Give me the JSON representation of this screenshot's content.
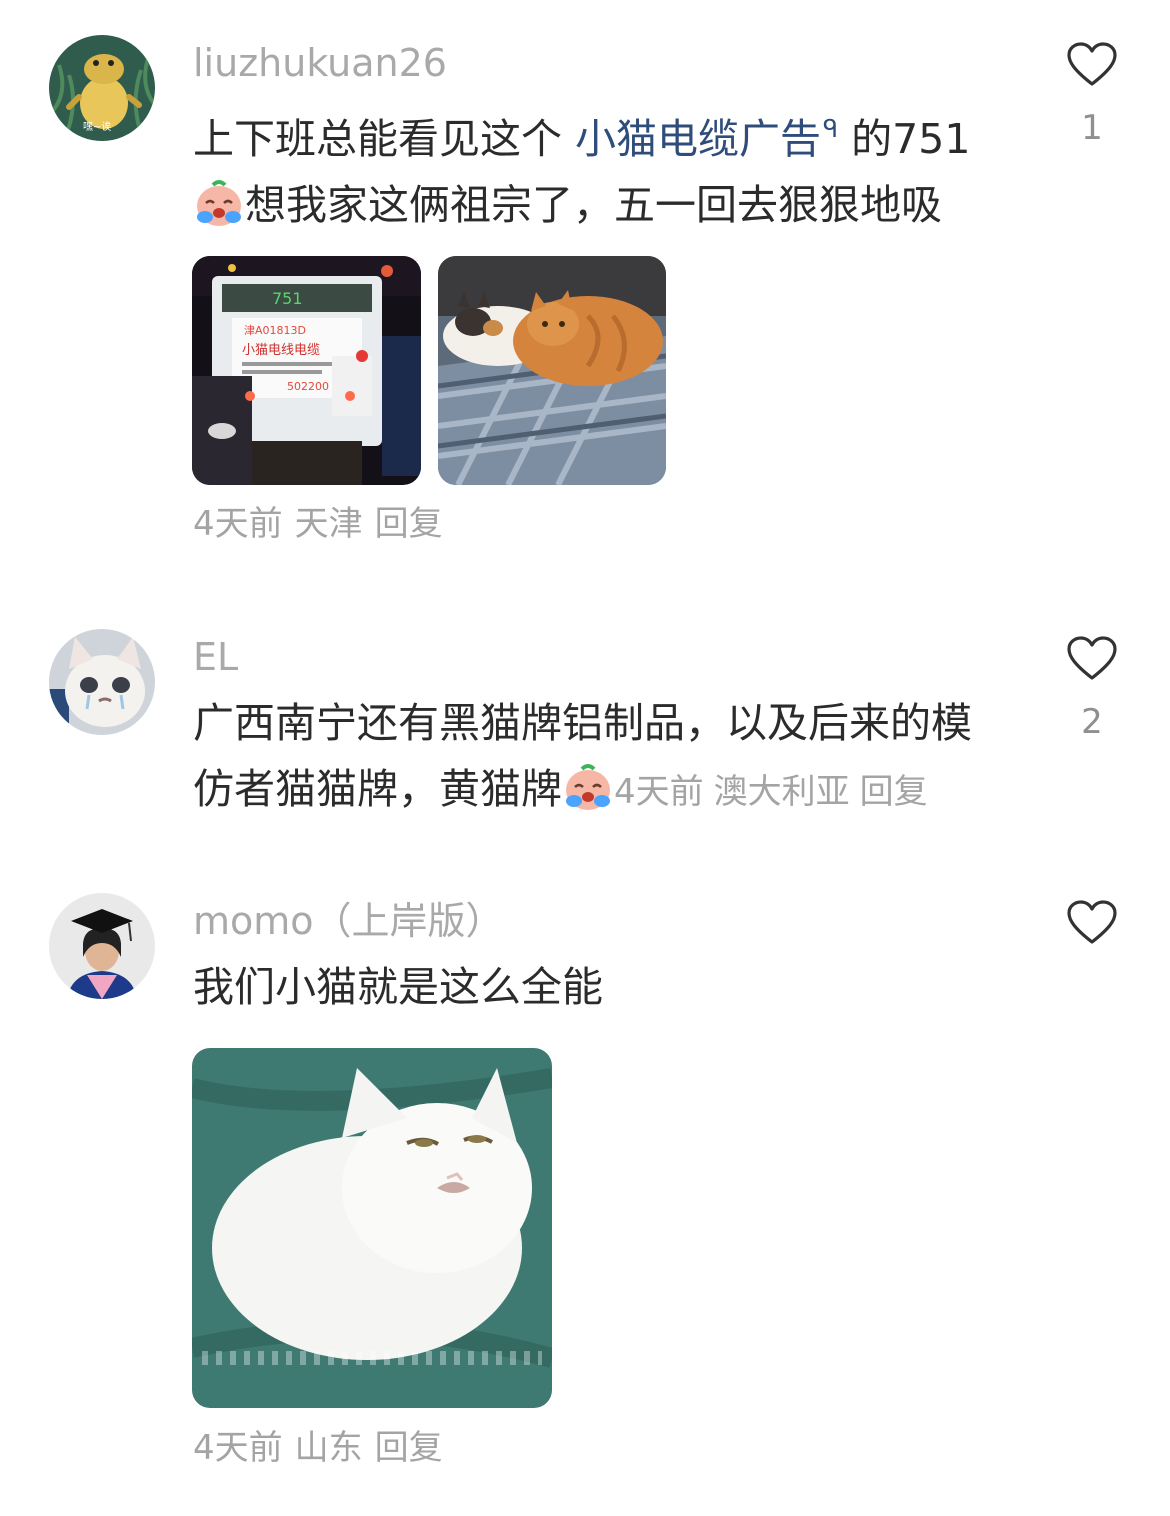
{
  "comments": [
    {
      "username": "liuzhukuan26",
      "text_before": "上下班总能看见这个 ",
      "link": "小猫电缆广告",
      "text_after_link": " 的751",
      "line2": "想我家这俩祖宗了，五一回去狠狠地吸",
      "time": "4天前",
      "location": "天津",
      "reply": "回复",
      "likes": "1",
      "image1_sign_top": "751",
      "image1_sign_plate": "津A01813D",
      "image1_sign_title": "小猫电线电缆",
      "image1_sign_phone": "502200",
      "avatar_caption": "嘿~诶"
    },
    {
      "username": "EL",
      "line1": "广西南宁还有黑猫牌铝制品，以及后来的模",
      "line2": "仿者猫猫牌，黄猫牌",
      "time": "4天前",
      "location": "澳大利亚",
      "reply": "回复",
      "likes": "2"
    },
    {
      "username": "momo（上岸版）",
      "text": "我们小猫就是这么全能",
      "time": "4天前",
      "location": "山东",
      "reply": "回复",
      "likes": ""
    }
  ],
  "icons": {
    "like": "heart-outline-icon",
    "search": "search-icon",
    "emoji": "crying-face-emoji"
  },
  "colors": {
    "username": "#a9a9a9",
    "text": "#2b2b2b",
    "link": "#2f4d7a",
    "meta": "#a4a4a4"
  }
}
